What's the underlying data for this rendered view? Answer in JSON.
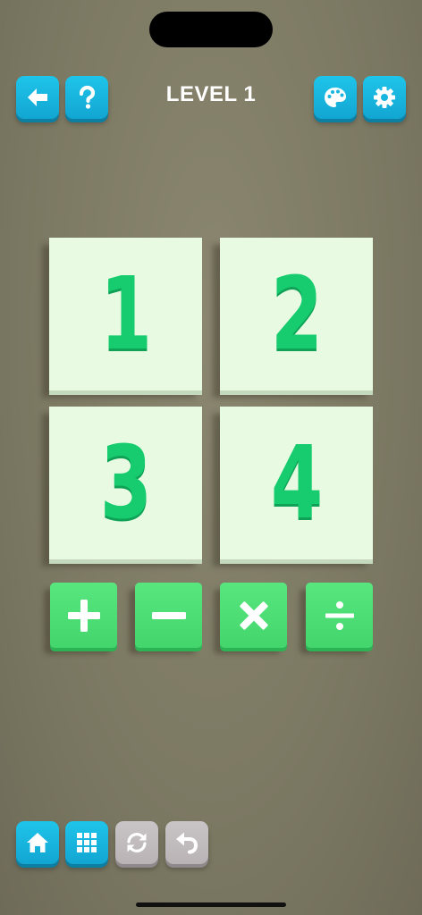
{
  "header": {
    "title": "LEVEL 1",
    "back_icon": "arrow-left-icon",
    "help_icon": "question-icon",
    "theme_icon": "palette-icon",
    "settings_icon": "gear-icon"
  },
  "tiles": [
    "1",
    "2",
    "3",
    "4"
  ],
  "operators": [
    {
      "name": "plus",
      "icon": "plus-icon"
    },
    {
      "name": "minus",
      "icon": "minus-icon"
    },
    {
      "name": "multiply",
      "icon": "times-icon"
    },
    {
      "name": "divide",
      "icon": "divide-icon"
    }
  ],
  "footer": {
    "home_icon": "home-icon",
    "levels_icon": "grid-icon",
    "restart_icon": "restart-icon",
    "undo_icon": "undo-icon"
  },
  "colors": {
    "background": "#7f7c66",
    "accent_blue": "#17b5df",
    "tile_bg": "#e8fbe2",
    "digit_green": "#17cc6e",
    "operator_green": "#4cdd73",
    "disabled_gray": "#c2bcbf"
  }
}
